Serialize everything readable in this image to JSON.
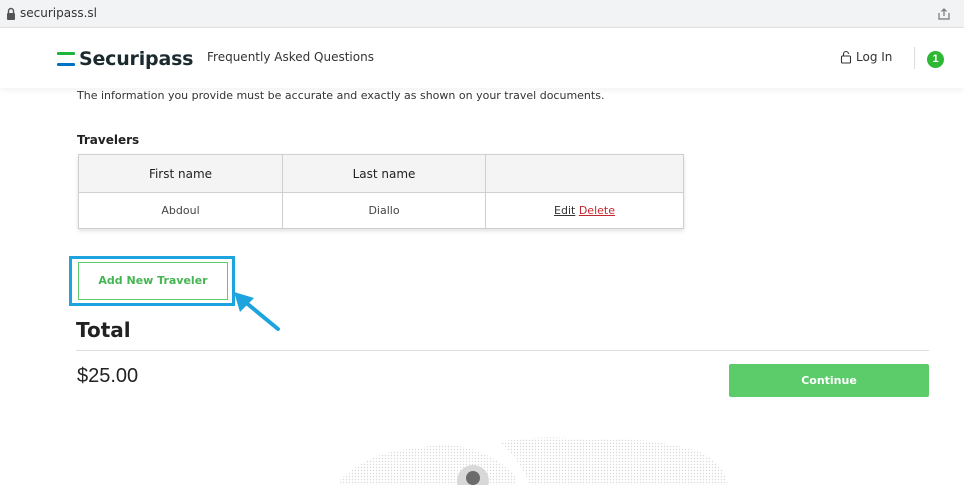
{
  "browser": {
    "url": "securipass.sl"
  },
  "header": {
    "brand": "Securipass",
    "brand_colors": [
      "#1eb53a",
      "#ffffff",
      "#0072c6"
    ],
    "nav_faq": "Frequently Asked Questions",
    "login_label": "Log In",
    "cart_count": "1"
  },
  "content": {
    "notice": "The information you provide must be accurate and exactly as shown on your travel documents.",
    "travelers_title": "Travelers",
    "table": {
      "columns": [
        "First name",
        "Last name",
        ""
      ],
      "rows": [
        {
          "first_name": "Abdoul",
          "last_name": "Diallo",
          "edit": "Edit",
          "delete": "Delete"
        }
      ]
    },
    "add_traveler_label": "Add New Traveler",
    "total_title": "Total",
    "total_amount": "$25.00",
    "continue_label": "Continue"
  },
  "colors": {
    "accent_green": "#5ccb6a",
    "highlight_blue": "#1da3dd",
    "delete_red": "#c0262d",
    "badge_green": "#2eb835"
  }
}
